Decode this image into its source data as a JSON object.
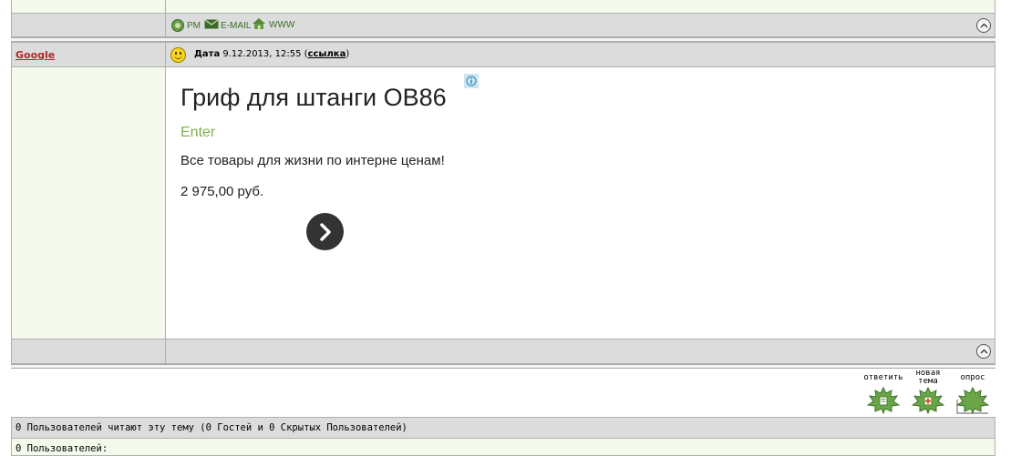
{
  "prev_post": {
    "links": {
      "pm": "PM",
      "email": "E-MAIL",
      "www": "WWW"
    }
  },
  "post": {
    "author": "Google",
    "date_label": "Дата",
    "date_value": "9.12.2013, 12:55",
    "link_label": "ссылка",
    "ad": {
      "title": "Гриф для штанги OB86",
      "source": "Enter",
      "description": "Все товары для жизни по интерне ценам!",
      "price": "2 975,00 руб."
    }
  },
  "actions": {
    "reply": "ответить",
    "new_topic_line1": "новая",
    "new_topic_line2": "тема",
    "poll": "опрос"
  },
  "footer": {
    "readers": "0 Пользователей читают эту тему (0 Гостей и 0 Скрытых Пользователей)",
    "users": "0 Пользователей:"
  },
  "colors": {
    "author_link": "#b3262b",
    "bar_gray": "#dcdcdc",
    "cell_green": "#f4faeb",
    "ad_accent": "#7fb24e"
  }
}
